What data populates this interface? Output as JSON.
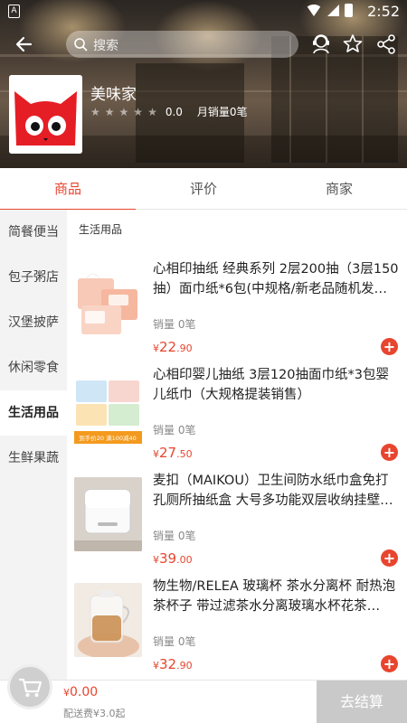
{
  "status_bar": {
    "time": "2:52"
  },
  "search": {
    "placeholder": "搜索"
  },
  "shop": {
    "name": "美味家",
    "rating": "0.0",
    "rating_stars": 0,
    "monthly_sales": "月销量0笔"
  },
  "tabs": [
    {
      "label": "商品",
      "active": true
    },
    {
      "label": "评价",
      "active": false
    },
    {
      "label": "商家",
      "active": false
    }
  ],
  "sidebar": {
    "items": [
      {
        "label": "简餐便当",
        "active": false
      },
      {
        "label": "包子粥店",
        "active": false
      },
      {
        "label": "汉堡披萨",
        "active": false
      },
      {
        "label": "休闲零食",
        "active": false
      },
      {
        "label": "生活用品",
        "active": true
      },
      {
        "label": "生鲜果蔬",
        "active": false
      }
    ]
  },
  "category_title": "生活用品",
  "products": [
    {
      "title": "心相印抽纸 经典系列 2层200抽（3层150抽）面巾纸*6包(中规格/新老品随机发…",
      "sales": "销量 0笔",
      "currency": "¥",
      "price_int": "22",
      "price_dec": ".90",
      "image_text": ""
    },
    {
      "title": "心相印婴儿抽纸 3层120抽面巾纸*3包婴儿纸巾（大规格提装销售）",
      "sales": "销量 0笔",
      "currency": "¥",
      "price_int": "27",
      "price_dec": ".50",
      "image_text": "到手价20 满100减40"
    },
    {
      "title": "麦扣（MAIKOU）卫生间防水纸巾盒免打孔厕所抽纸盒 大号多功能双层收纳挂壁…",
      "sales": "销量 0笔",
      "currency": "¥",
      "price_int": "39",
      "price_dec": ".00",
      "image_text": ""
    },
    {
      "title": "物生物/RELEA 玻璃杯 茶水分离杯 耐热泡茶杯子 带过滤茶水分离玻璃水杯花茶…",
      "sales": "销量 0笔",
      "currency": "¥",
      "price_int": "32",
      "price_dec": ".90",
      "image_text": ""
    }
  ],
  "cart": {
    "currency": "¥",
    "total": "0.00",
    "delivery_note": "配送费¥3.0起",
    "checkout_label": "去结算"
  },
  "colors": {
    "accent": "#e8452f",
    "checkout_disabled": "#c9c9c9",
    "sidebar_bg": "#f3f3f3"
  }
}
